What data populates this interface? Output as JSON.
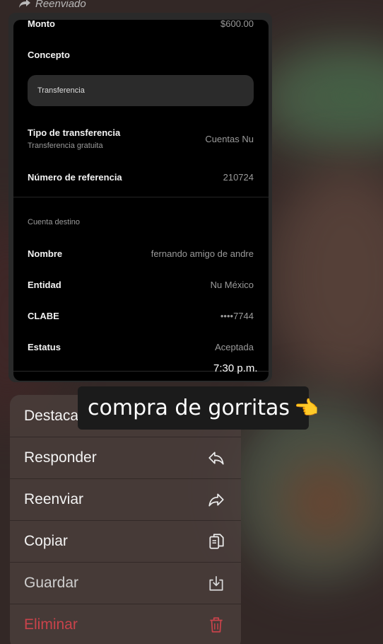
{
  "forwarded_label": "Reenviado",
  "receipt": {
    "monto": {
      "label": "Monto",
      "value": "$600.00"
    },
    "concepto": {
      "label": "Concepto",
      "value": "Transferencia"
    },
    "tipo": {
      "label": "Tipo de transferencia",
      "sub": "Transferencia gratuita",
      "value": "Cuentas Nu"
    },
    "referencia": {
      "label": "Número de referencia",
      "value": "210724"
    },
    "section_title": "Cuenta destino",
    "nombre": {
      "label": "Nombre",
      "value": "fernando amigo de andre"
    },
    "entidad": {
      "label": "Entidad",
      "value": "Nu México"
    },
    "clabe": {
      "label": "CLABE",
      "value": "••••7744"
    },
    "estatus": {
      "label": "Estatus",
      "value": "Aceptada"
    }
  },
  "message_time": "7:30 p.m.",
  "caption": {
    "text": "compra de gorritas",
    "emoji": "👈"
  },
  "menu": {
    "items": [
      {
        "label": "Destacar",
        "icon": "star-icon"
      },
      {
        "label": "Responder",
        "icon": "reply-icon"
      },
      {
        "label": "Reenviar",
        "icon": "forward-icon"
      },
      {
        "label": "Copiar",
        "icon": "copy-icon"
      },
      {
        "label": "Guardar",
        "icon": "save-icon"
      },
      {
        "label": "Eliminar",
        "icon": "trash-icon",
        "color": "#c9434b"
      }
    ]
  }
}
